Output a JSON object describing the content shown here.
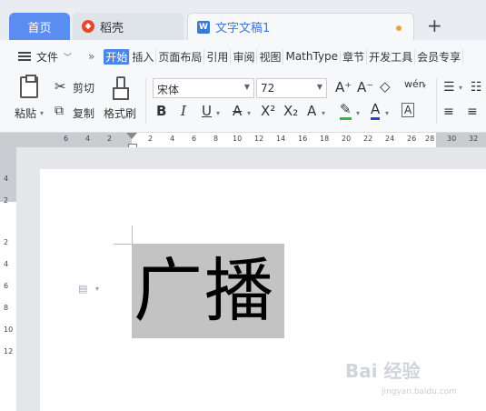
{
  "tabs": {
    "home": "首页",
    "daoke": "稻壳",
    "doc": "文字文稿1",
    "new_tab": "+"
  },
  "menu": {
    "file": "文件",
    "more": "»",
    "items": [
      "开始",
      "插入",
      "页面布局",
      "引用",
      "审阅",
      "视图",
      "MathType",
      "章节",
      "开发工具",
      "会员专享"
    ]
  },
  "ribbon": {
    "paste": "粘贴",
    "cut": "剪切",
    "copy": "复制",
    "format_painter": "格式刷",
    "font": "宋体",
    "size": "72",
    "grow": "A⁺",
    "shrink": "A⁻",
    "clear": "◇",
    "pinyin": "wén",
    "bold": "B",
    "italic": "I",
    "underline": "U",
    "strike": "A",
    "superscript": "X²",
    "subscript": "X₂",
    "effect": "A",
    "highlight": "✎",
    "font_color": "A",
    "border": "A"
  },
  "ruler": {
    "h_ticks": [
      "6",
      "4",
      "2",
      "2",
      "4",
      "6",
      "8",
      "10",
      "12",
      "14",
      "16",
      "18",
      "20",
      "22",
      "24",
      "26",
      "28",
      "30",
      "32"
    ],
    "v_ticks": [
      "4",
      "2",
      "2",
      "4",
      "6",
      "8",
      "10",
      "12"
    ]
  },
  "document": {
    "selected_text": "广播"
  },
  "watermark": {
    "logo": "Bai 经验",
    "url": "jingyan.baidu.com"
  },
  "colors": {
    "accent": "#4a86e8",
    "home_tab": "#5b8cf0",
    "selection": "#c3c3c3"
  }
}
